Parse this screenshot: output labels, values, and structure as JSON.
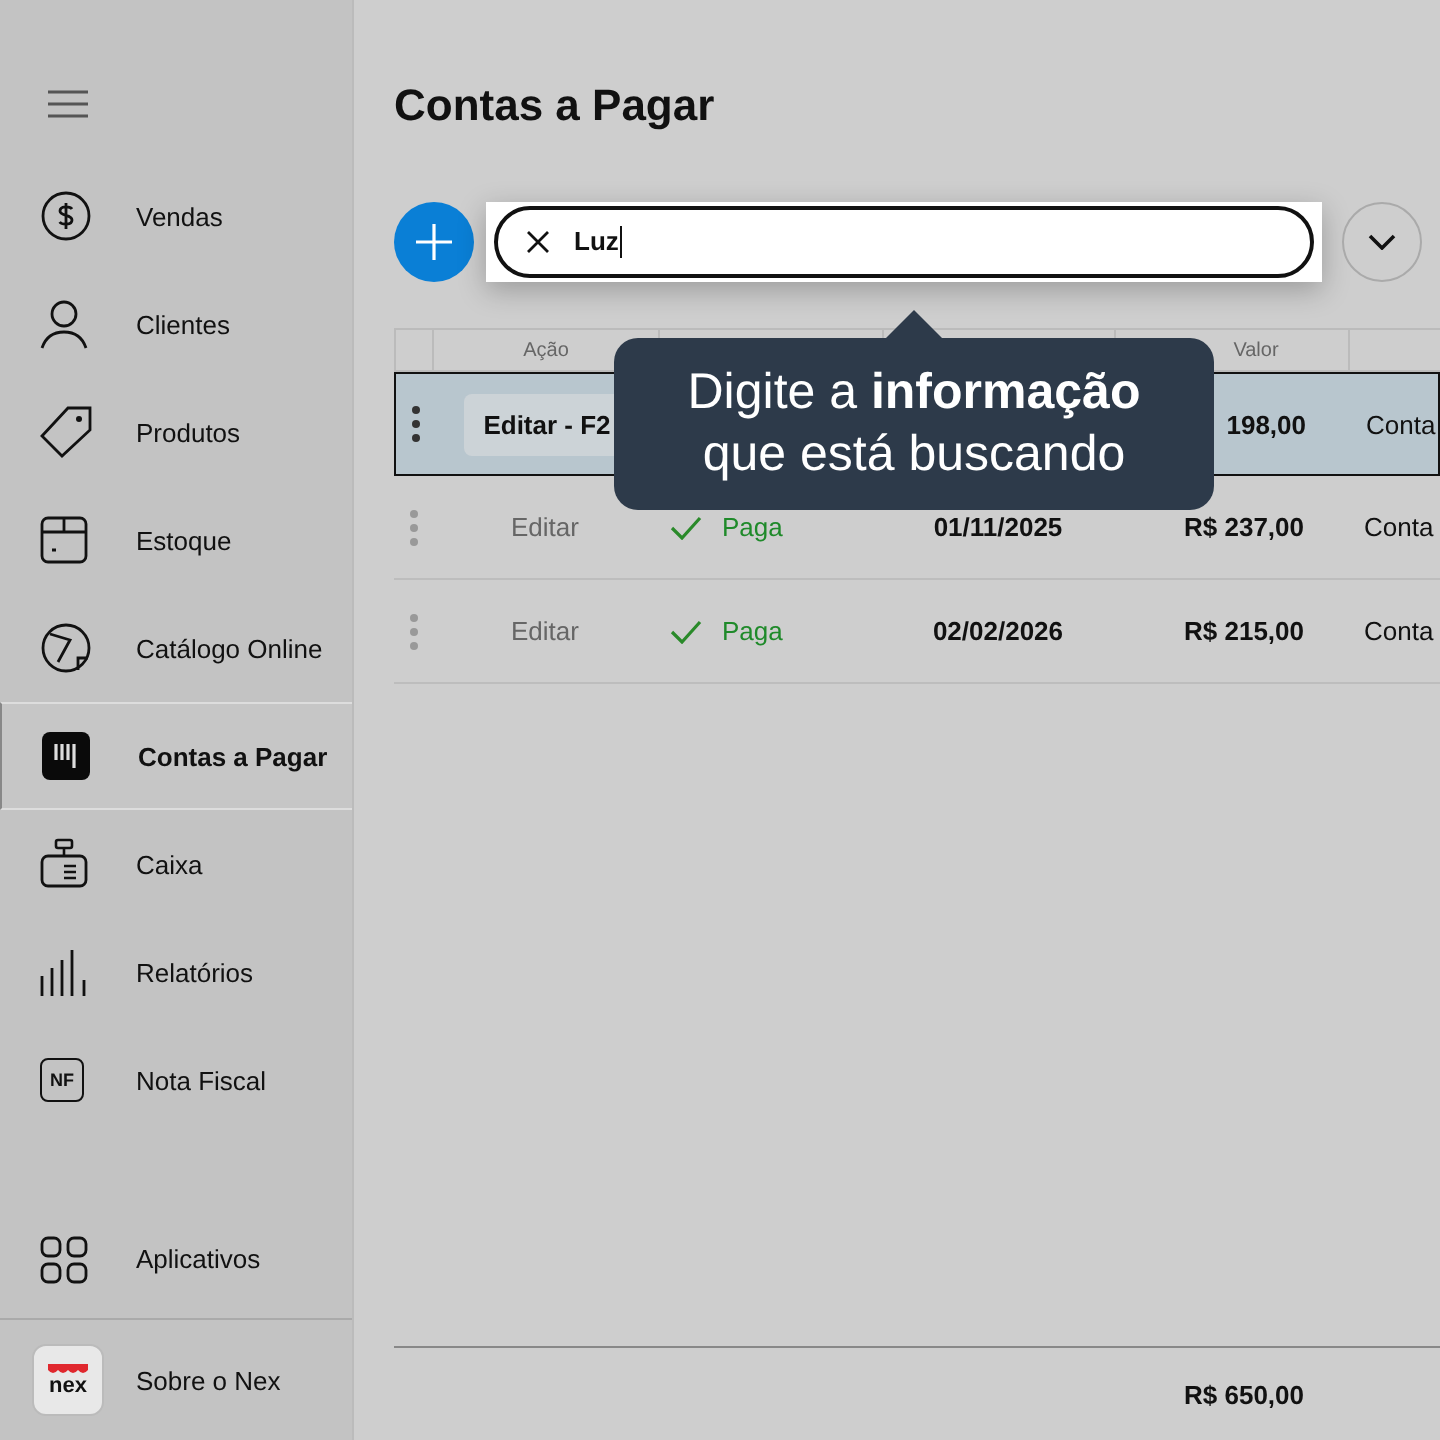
{
  "sidebar": {
    "items": [
      {
        "label": "Vendas",
        "selected": false
      },
      {
        "label": "Clientes",
        "selected": false
      },
      {
        "label": "Produtos",
        "selected": false
      },
      {
        "label": "Estoque",
        "selected": false
      },
      {
        "label": "Catálogo Online",
        "selected": false
      },
      {
        "label": "Contas a Pagar",
        "selected": true
      },
      {
        "label": "Caixa",
        "selected": false
      },
      {
        "label": "Relatórios",
        "selected": false
      },
      {
        "label": "Nota Fiscal",
        "selected": false,
        "icon_text": "NF"
      }
    ],
    "apps": {
      "label": "Aplicativos"
    },
    "about": {
      "label": "Sobre o Nex",
      "logo_text": "nex"
    }
  },
  "page": {
    "title": "Contas a Pagar"
  },
  "search": {
    "value": "Luz"
  },
  "table": {
    "columns": [
      "Ação",
      "Valor"
    ],
    "rows": [
      {
        "action": "Editar - F2",
        "value": "198,00",
        "description": "Conta",
        "selected": true
      },
      {
        "action": "Editar",
        "status": "Paga",
        "date": "01/11/2025",
        "value": "R$ 237,00",
        "description": "Conta",
        "selected": false
      },
      {
        "action": "Editar",
        "status": "Paga",
        "date": "02/02/2026",
        "value": "R$ 215,00",
        "description": "Conta",
        "selected": false
      }
    ],
    "total": "R$ 650,00"
  },
  "tooltip": {
    "text": "Digite a **informação** que está buscando"
  }
}
